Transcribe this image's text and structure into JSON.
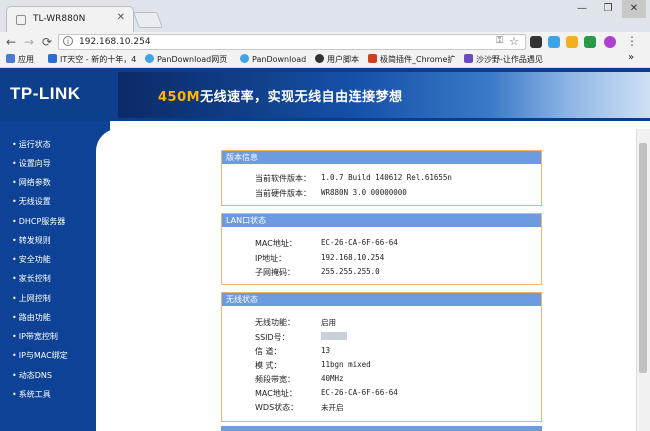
{
  "browser": {
    "tab_title": "TL-WR880N",
    "tab_close": "✕",
    "url": "192.168.10.254",
    "win": {
      "min": "—",
      "max": "❐",
      "close": "✕"
    },
    "bookmarks": [
      {
        "label": "应用",
        "color": "#4a7bd0"
      },
      {
        "label": "IT天空 - 新的十年，4",
        "color": "#2a6fcf"
      },
      {
        "label": "PanDownload网页",
        "color": "#3fa3e8"
      },
      {
        "label": "PanDownload",
        "color": "#3fa3e8"
      },
      {
        "label": "用户脚本",
        "color": "#333333"
      },
      {
        "label": "极简插件_Chrome扩",
        "color": "#d04020"
      },
      {
        "label": "沙沙野-让作品遇见",
        "color": "#6a4cc0"
      }
    ],
    "more": "»"
  },
  "banner": {
    "logo": "TP-LINK",
    "slogan_highlight": "450M",
    "slogan_rest": "无线速率，实现无线自由连接梦想"
  },
  "sidebar": {
    "items": [
      "运行状态",
      "设置向导",
      "网络参数",
      "无线设置",
      "DHCP服务器",
      "转发规则",
      "安全功能",
      "家长控制",
      "上网控制",
      "路由功能",
      "IP带宽控制",
      "IP与MAC绑定",
      "动态DNS",
      "系统工具"
    ]
  },
  "version": {
    "title": "版本信息",
    "software_label": "当前软件版本：",
    "software_value": "1.0.7 Build 140612 Rel.61655n",
    "hardware_label": "当前硬件版本：",
    "hardware_value": "WR880N 3.0 00000000"
  },
  "lan": {
    "title": "LAN口状态",
    "mac_label": "MAC地址：",
    "mac_value": "EC-26-CA-6F-66-64",
    "ip_label": "IP地址：",
    "ip_value": "192.168.10.254",
    "mask_label": "子网掩码：",
    "mask_value": "255.255.255.0"
  },
  "wireless": {
    "title": "无线状态",
    "func_label": "无线功能：",
    "func_value": "启用",
    "ssid_label": "SSID号：",
    "channel_label": "信 道：",
    "channel_value": "13",
    "mode_label": "模 式：",
    "mode_value": "11bgn mixed",
    "bw_label": "频段带宽：",
    "bw_value": "40MHz",
    "mac_label": "MAC地址：",
    "mac_value": "EC-26-CA-6F-66-64",
    "wds_label": "WDS状态：",
    "wds_value": "未开启"
  }
}
